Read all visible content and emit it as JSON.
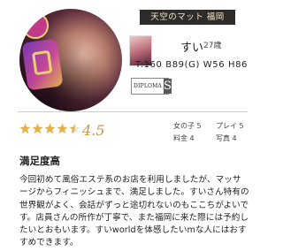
{
  "shop": {
    "name": "天空のマット 福岡"
  },
  "cast": {
    "name": "すい",
    "age": "27歳",
    "measurements": "T:160 B89(G) W56 H86"
  },
  "diploma": {
    "label": "DIPLOMA",
    "rank": "S"
  },
  "rating": {
    "stars": 4.5,
    "max": 5,
    "value_text": "4.5"
  },
  "metrics": [
    {
      "label": "女の子",
      "value": "5"
    },
    {
      "label": "プレイ",
      "value": "5"
    },
    {
      "label": "料金",
      "value": "4"
    },
    {
      "label": "写真",
      "value": "4"
    }
  ],
  "review": {
    "title": "満足度高",
    "body": "今回初めて風俗エステ系のお店を利用しましたが、マッサージからフィニッシュまで、満足しました。すいさん特有の世界観がよく、会話がずっと途切れないのもここちがよいです。店員さんの所作が丁寧で、また福岡に来た際には予約したいとおもいます。すいworldを体感したいmな人にはおすすめできます。"
  },
  "colors": {
    "star": "#e3b34a",
    "rating_text": "#c79a3a",
    "banner_bg": "#2e2b2b"
  },
  "icons": {
    "star": "star-icon",
    "photo": "cast-photo"
  }
}
